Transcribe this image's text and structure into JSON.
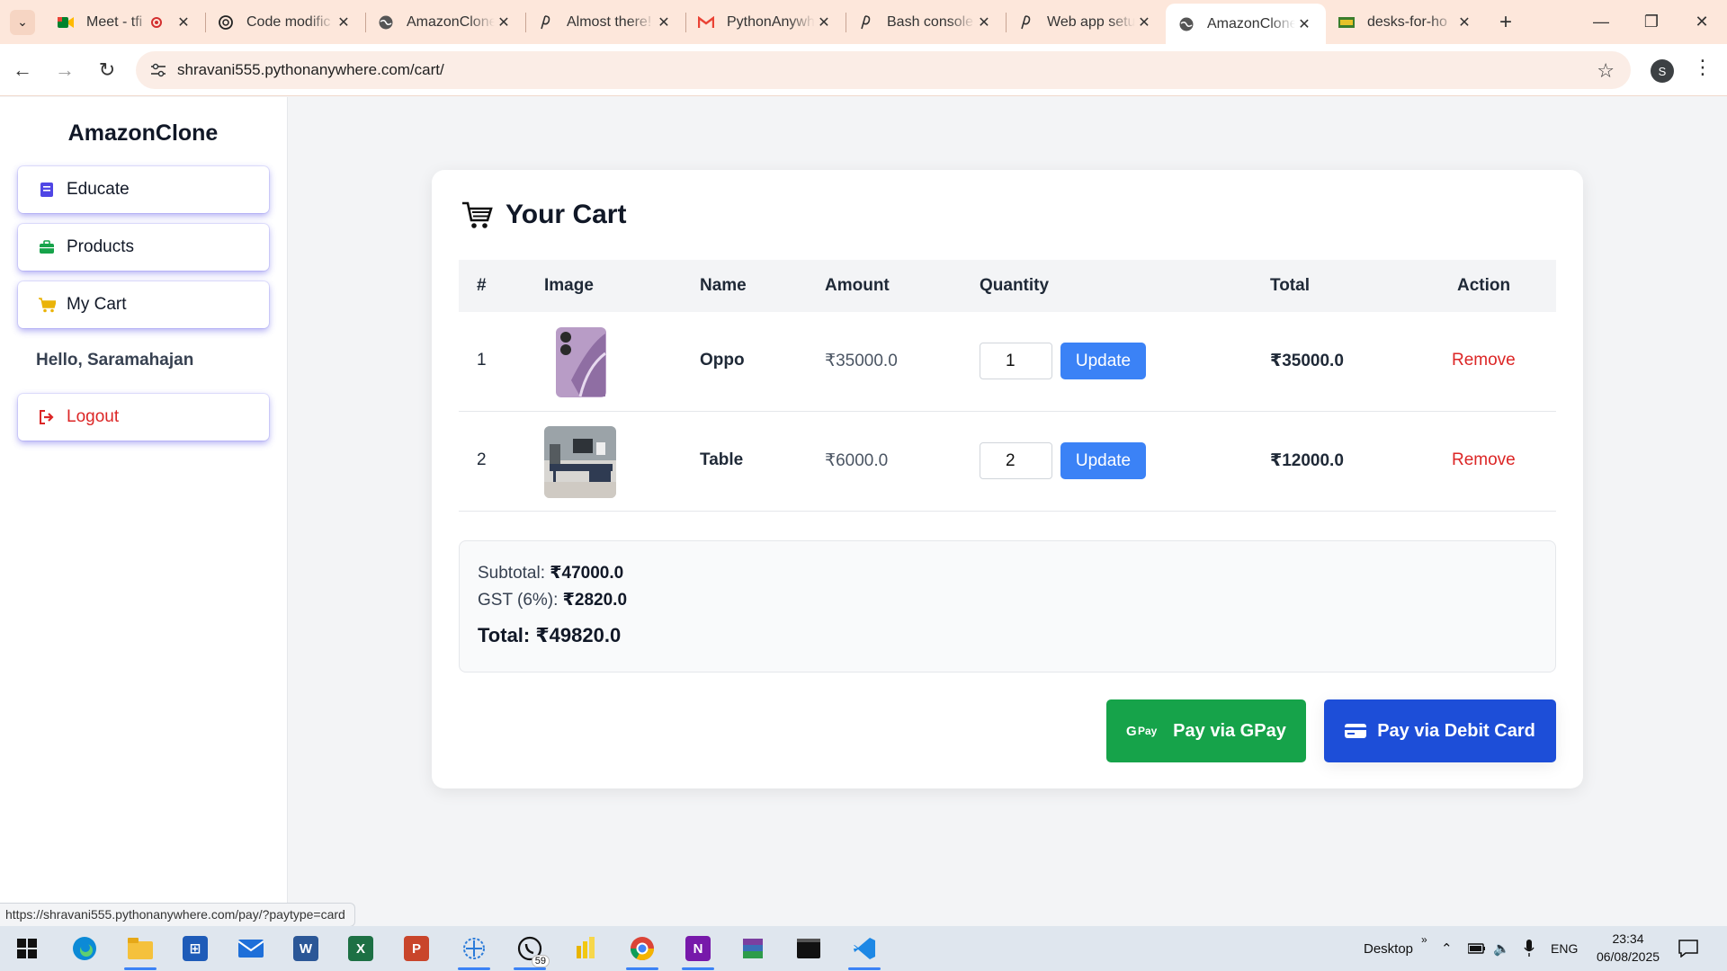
{
  "browser": {
    "tabs": [
      {
        "label": "Meet - tfi",
        "icon": "meet-icon",
        "recording": true
      },
      {
        "label": "Code modific",
        "icon": "chatgpt-icon"
      },
      {
        "label": "AmazonClone",
        "icon": "globe-icon"
      },
      {
        "label": "Almost there!",
        "icon": "pythonanywhere-icon"
      },
      {
        "label": "PythonAnywh",
        "icon": "gmail-icon"
      },
      {
        "label": "Bash console",
        "icon": "pythonanywhere-icon"
      },
      {
        "label": "Web app setu",
        "icon": "pythonanywhere-icon"
      },
      {
        "label": "AmazonClone",
        "icon": "globe-icon",
        "active": true
      },
      {
        "label": "desks-for-ho",
        "icon": "image-icon"
      }
    ],
    "url": "shravani555.pythonanywhere.com/cart/",
    "profile_initial": "S",
    "status_url": "https://shravani555.pythonanywhere.com/pay/?paytype=card"
  },
  "sidebar": {
    "brand": "AmazonClone",
    "items": [
      {
        "label": "Educate",
        "icon": "book-icon"
      },
      {
        "label": "Products",
        "icon": "briefcase-icon"
      },
      {
        "label": "My Cart",
        "icon": "cart-icon"
      }
    ],
    "greeting": "Hello, Saramahajan",
    "logout_label": "Logout"
  },
  "cart": {
    "title": "Your Cart",
    "columns": [
      "#",
      "Image",
      "Name",
      "Amount",
      "Quantity",
      "Total",
      "Action"
    ],
    "rows": [
      {
        "index": "1",
        "name": "Oppo",
        "amount": "₹35000.0",
        "quantity": "1",
        "update_label": "Update",
        "total": "₹35000.0",
        "action": "Remove",
        "image": "phone-image"
      },
      {
        "index": "2",
        "name": "Table",
        "amount": "₹6000.0",
        "quantity": "2",
        "update_label": "Update",
        "total": "₹12000.0",
        "action": "Remove",
        "image": "desk-image"
      }
    ],
    "summary": {
      "subtotal_label": "Subtotal:",
      "subtotal_value": "₹47000.0",
      "gst_label": "GST (6%):",
      "gst_value": "₹2820.0",
      "total_label": "Total:",
      "total_value": "₹49820.0"
    },
    "pay_gpay_label": "Pay via GPay",
    "pay_card_label": "Pay via Debit Card",
    "gpay_logo_text": "G Pay"
  },
  "taskbar": {
    "whatsapp_badge": "59",
    "desktop_label": "Desktop",
    "lang": "ENG",
    "time": "23:34",
    "date": "06/08/2025"
  },
  "colors": {
    "tabbar_bg": "#fde7db",
    "accent_blue": "#3b82f6",
    "remove_red": "#dc2626",
    "gpay_green": "#16a34a",
    "card_blue": "#1d4ed8"
  }
}
